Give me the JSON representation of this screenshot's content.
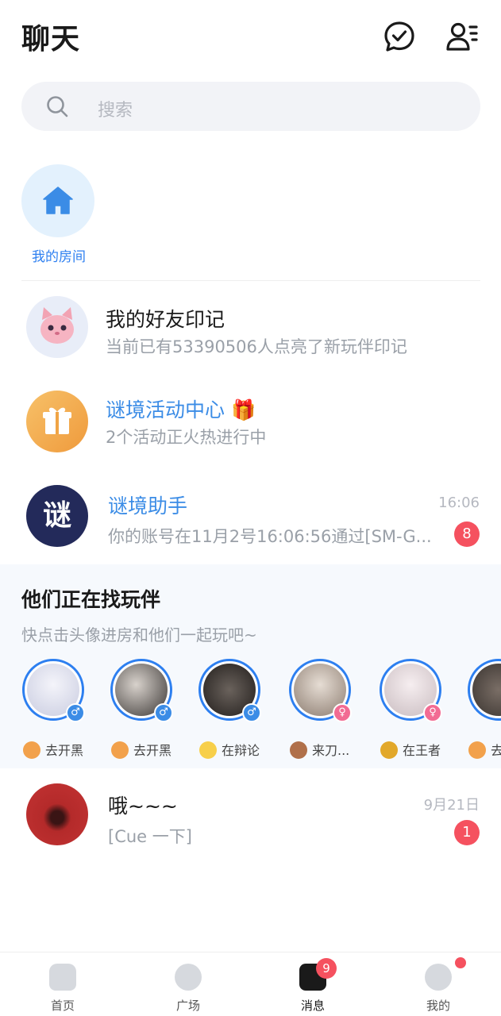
{
  "header": {
    "title": "聊天"
  },
  "search": {
    "placeholder": "搜索"
  },
  "my_room": {
    "label": "我的房间"
  },
  "conversations": [
    {
      "name": "我的好友印记",
      "subtitle": "当前已有53390506人点亮了新玩伴印记"
    },
    {
      "name": "谜境活动中心",
      "emoji": "🎁",
      "subtitle": "2个活动正火热进行中"
    },
    {
      "name": "谜境助手",
      "avatar_text": "谜",
      "subtitle": "你的账号在11月2号16:06:56通过[SM-G...",
      "time": "16:06",
      "unread": "8"
    }
  ],
  "finding_partners": {
    "title": "他们正在找玩伴",
    "subtitle": "快点击头像进房和他们一起玩吧~",
    "players": [
      {
        "status": "去开黑",
        "gender": "male"
      },
      {
        "status": "去开黑",
        "gender": "male"
      },
      {
        "status": "在辩论",
        "gender": "male"
      },
      {
        "status": "来刀...",
        "gender": "female"
      },
      {
        "status": "在王者",
        "gender": "female"
      },
      {
        "status": "去",
        "gender": "male"
      }
    ]
  },
  "chat": {
    "name": "哦~~~",
    "preview": "[Cue 一下]",
    "time": "9月21日",
    "unread": "1"
  },
  "bottom_nav": {
    "items": [
      {
        "label": "首页"
      },
      {
        "label": "广场"
      },
      {
        "label": "消息"
      },
      {
        "label": "我的"
      }
    ],
    "messages_badge": "9"
  },
  "colors": {
    "accent": "#2d7ff0",
    "badge": "#f5515f",
    "section_bg": "#f6f9fd"
  }
}
